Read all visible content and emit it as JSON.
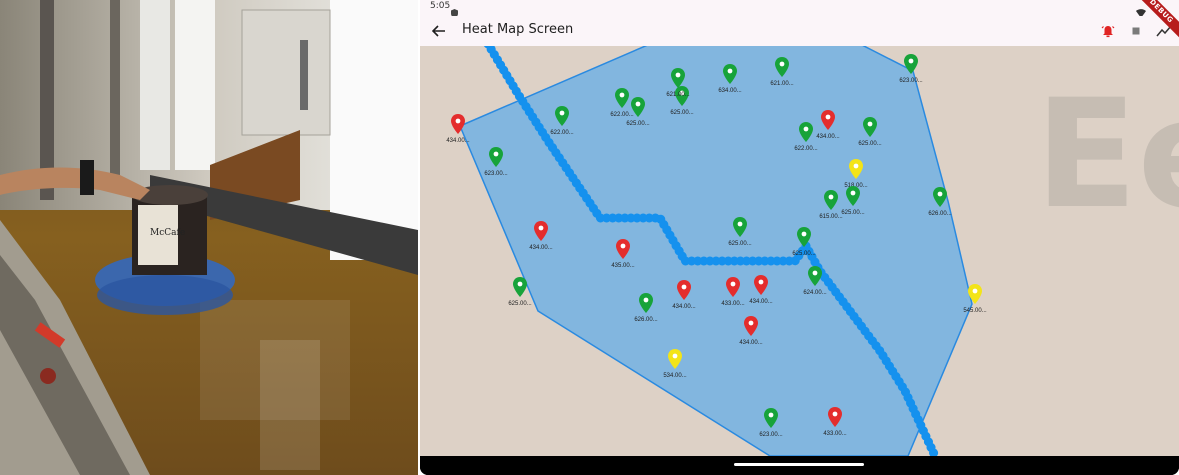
{
  "status_bar": {
    "time": "5:05"
  },
  "app_bar": {
    "title": "Heat Map Screen"
  },
  "debug_banner": "DEBUG",
  "colors": {
    "green": "#17a33a",
    "red": "#e42d2d",
    "yellow": "#f3e418",
    "polygon_fill": "#7ab3e1",
    "polygon_stroke": "#2a8ae0",
    "path": "#1591ee"
  },
  "markers": [
    {
      "label": "434.00...",
      "color": "red"
    },
    {
      "label": "622.00...",
      "color": "green"
    },
    {
      "label": "622.00...",
      "color": "green"
    },
    {
      "label": "625.00...",
      "color": "green"
    },
    {
      "label": "625.00...",
      "color": "green"
    },
    {
      "label": "621.00...",
      "color": "green"
    },
    {
      "label": "634.00...",
      "color": "green"
    },
    {
      "label": "621.00...",
      "color": "green"
    },
    {
      "label": "623.00...",
      "color": "green"
    },
    {
      "label": "623.00...",
      "color": "green"
    },
    {
      "label": "622.00...",
      "color": "green"
    },
    {
      "label": "434.00...",
      "color": "red"
    },
    {
      "label": "625.00...",
      "color": "green"
    },
    {
      "label": "518.00...",
      "color": "yellow"
    },
    {
      "label": "615.00...",
      "color": "green"
    },
    {
      "label": "625.00...",
      "color": "green"
    },
    {
      "label": "626.00...",
      "color": "green"
    },
    {
      "label": "434.00...",
      "color": "red"
    },
    {
      "label": "435.00...",
      "color": "red"
    },
    {
      "label": "625.00...",
      "color": "green"
    },
    {
      "label": "625.00...",
      "color": "green"
    },
    {
      "label": "624.00...",
      "color": "green"
    },
    {
      "label": "625.00...",
      "color": "green"
    },
    {
      "label": "626.00...",
      "color": "green"
    },
    {
      "label": "434.00...",
      "color": "red"
    },
    {
      "label": "433.00...",
      "color": "red"
    },
    {
      "label": "434.00...",
      "color": "red"
    },
    {
      "label": "434.00...",
      "color": "red"
    },
    {
      "label": "545.00...",
      "color": "yellow"
    },
    {
      "label": "534.00...",
      "color": "yellow"
    },
    {
      "label": "623.00...",
      "color": "green"
    },
    {
      "label": "433.00...",
      "color": "red"
    }
  ]
}
